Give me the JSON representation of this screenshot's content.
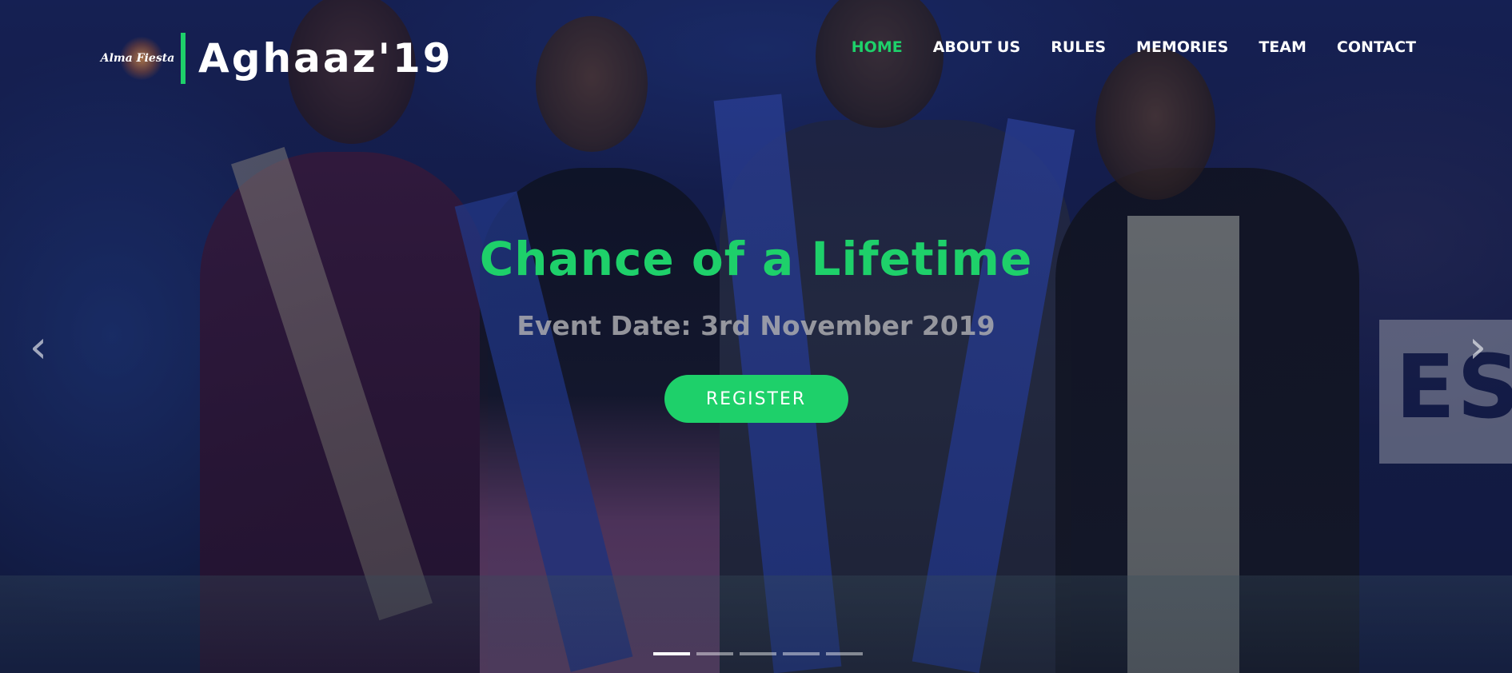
{
  "header": {
    "logo_text": "Alma Fiesta",
    "brand_title": "Aghaaz'19",
    "nav": [
      {
        "label": "HOME",
        "active": true
      },
      {
        "label": "ABOUT US",
        "active": false
      },
      {
        "label": "RULES",
        "active": false
      },
      {
        "label": "MEMORIES",
        "active": false
      },
      {
        "label": "TEAM",
        "active": false
      },
      {
        "label": "CONTACT",
        "active": false
      }
    ]
  },
  "hero": {
    "title": "Chance of a Lifetime",
    "subtitle": "Event Date: 3rd November 2019",
    "register_label": "REGISTER",
    "background_banner_text": "ES"
  },
  "carousel": {
    "prev_icon": "chevron-left-icon",
    "next_icon": "chevron-right-icon",
    "prev_glyph": "‹",
    "next_glyph": "›",
    "slide_count": 5,
    "active_slide": 1
  },
  "colors": {
    "accent": "#1ed06a",
    "nav_text": "#ffffff",
    "subtitle": "#aaaaaf"
  }
}
